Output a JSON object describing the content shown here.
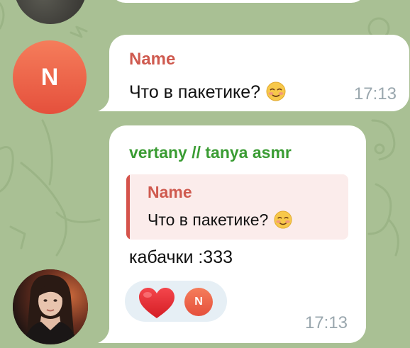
{
  "messages": [
    {
      "avatar_letter": "N",
      "sender": "Name",
      "text": "Что в пакетике?",
      "emoji": "smiling-blush-emoji",
      "time": "17:13"
    },
    {
      "avatar": "user-photo-avatar",
      "sender": "vertany // tanya asmr",
      "reply": {
        "sender": "Name",
        "text": "Что в пакетике?",
        "emoji": "smiling-blush-emoji"
      },
      "text": "кабачки :333",
      "reaction": {
        "emoji": "red-heart-icon",
        "reactor_letter": "N"
      },
      "time": "17:13"
    }
  ],
  "colors": {
    "background": "#a9c094",
    "bubble": "#ffffff",
    "sender_name": "#cf5a4f",
    "sender_vertany": "#3a9c33",
    "time": "#9aa7ae",
    "reply_bg": "#fbeceb",
    "reply_bar": "#d5534b",
    "avatar_n": "#e96449",
    "reaction_bg": "#e6eff5"
  }
}
